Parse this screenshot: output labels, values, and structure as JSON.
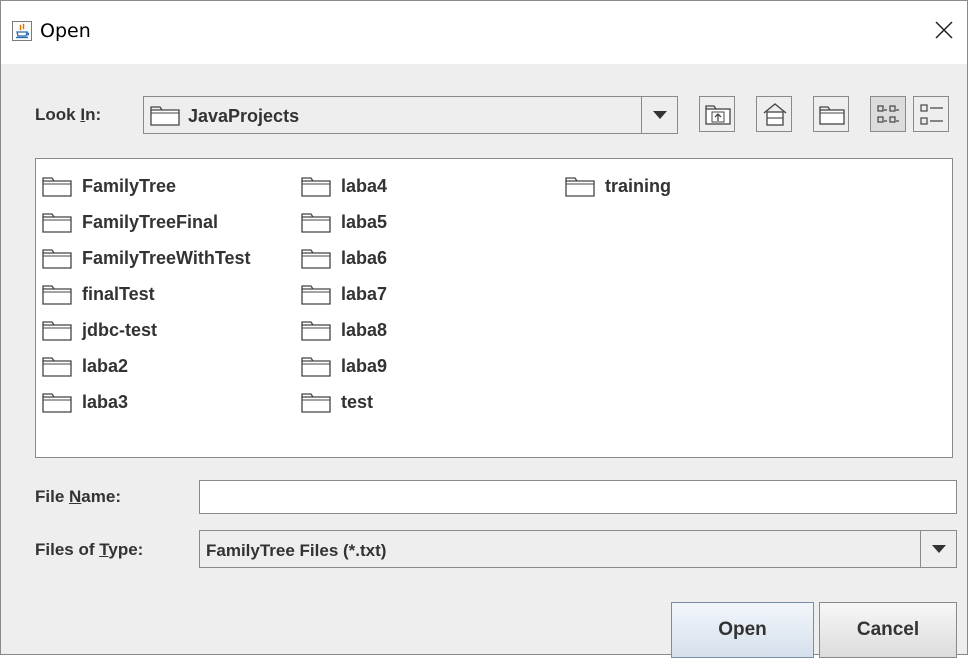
{
  "window": {
    "title": "Open",
    "icon": "java-icon",
    "close_icon": "close-icon"
  },
  "look_in": {
    "label_pre": "Look ",
    "label_mnemonic": "I",
    "label_post": "n:",
    "value": "JavaProjects"
  },
  "toolbar": {
    "buttons": [
      "up-one-level-icon",
      "home-icon",
      "new-folder-icon",
      "list-view-icon",
      "details-view-icon"
    ],
    "active": "list-view-icon"
  },
  "files": [
    "FamilyTree",
    "FamilyTreeFinal",
    "FamilyTreeWithTest",
    "finalTest",
    "jdbc-test",
    "laba2",
    "laba3",
    "laba4",
    "laba5",
    "laba6",
    "laba7",
    "laba8",
    "laba9",
    "test",
    "training"
  ],
  "file_name": {
    "label_pre": "File ",
    "label_mnemonic": "N",
    "label_post": "ame:",
    "value": ""
  },
  "file_type": {
    "label_pre": "Files of ",
    "label_mnemonic": "T",
    "label_post": "ype:",
    "value": "FamilyTree Files (*.txt)"
  },
  "buttons": {
    "open": "Open",
    "cancel": "Cancel"
  },
  "colors": {
    "window_bg": "#eeeeee",
    "border": "#8a8a8a",
    "text": "#333333"
  }
}
